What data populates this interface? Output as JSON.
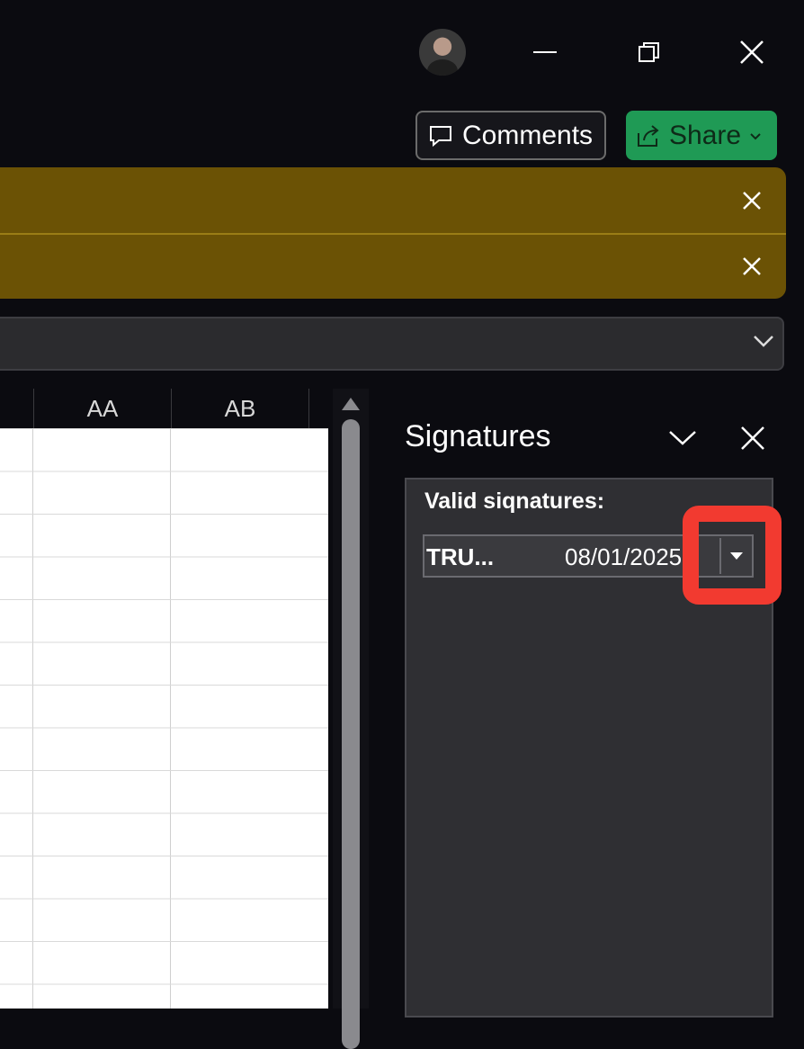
{
  "titlebar": {
    "avatar_icon": "user-avatar",
    "minimize_icon": "minimize-icon",
    "restore_icon": "restore-icon",
    "close_icon": "close-icon"
  },
  "toolbar": {
    "comments_label": "Comments",
    "share_label": "Share",
    "share_color": "#1f9a55"
  },
  "message_bars": {
    "color": "#6b5205",
    "count": 2
  },
  "grid": {
    "columns": [
      "AA",
      "AB"
    ]
  },
  "signatures_pane": {
    "title": "Signatures",
    "valid_label": "Valid siqnatures:",
    "signature": {
      "name": "TRU...",
      "date": "08/01/2025"
    },
    "highlight_color": "#f23a30"
  }
}
